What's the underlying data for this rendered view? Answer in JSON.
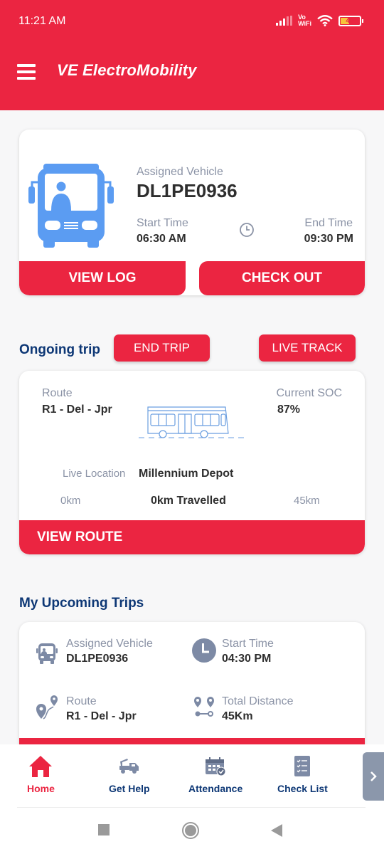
{
  "status_bar": {
    "time": "11:21 AM",
    "network": "Vo WiFi",
    "network_line1": "Vo",
    "network_line2": "WiFi",
    "battery": "40",
    "icons": [
      "signal-icon",
      "vowifi-icon",
      "wifi-icon",
      "battery-icon"
    ]
  },
  "header": {
    "title": "VE ElectroMobility",
    "menu_icon": "hamburger-menu-icon"
  },
  "colors": {
    "primary": "#eb2541",
    "heading": "#0d3775",
    "label": "#8b93a6",
    "bus_blue": "#5b9cf2"
  },
  "assignment_card": {
    "vehicle_label": "Assigned Vehicle",
    "vehicle_number": "DL1PE0936",
    "start_time_label": "Start Time",
    "start_time": "06:30 AM",
    "end_time_label": "End Time",
    "end_time": "09:30 PM",
    "view_log_label": "VIEW LOG",
    "check_out_label": "CHECK OUT"
  },
  "ongoing_trip": {
    "title": "Ongoing trip",
    "end_trip_label": "END TRIP",
    "live_track_label": "LIVE TRACK",
    "route_label": "Route",
    "route": "R1 - Del - Jpr",
    "soc_label": "Current SOC",
    "soc": "87%",
    "live_location_label": "Live Location",
    "live_location": "Millennium Depot",
    "start_km": "0km",
    "travelled": "0km Travelled",
    "end_km": "45km",
    "view_route_label": "VIEW ROUTE"
  },
  "upcoming_trips": {
    "title": "My Upcoming Trips",
    "trips": [
      {
        "vehicle_label": "Assigned Vehicle",
        "vehicle_number": "DL1PE0936",
        "start_time_label": "Start Time",
        "start_time": "04:30 PM",
        "route_label": "Route",
        "route": "R1 - Del - Jpr",
        "distance_label": "Total Distance",
        "distance": "45Km"
      }
    ]
  },
  "bottom_nav": {
    "items": [
      {
        "label": "Home",
        "icon": "home-icon",
        "active": true
      },
      {
        "label": "Get Help",
        "icon": "tow-truck-icon",
        "active": false
      },
      {
        "label": "Attendance",
        "icon": "calendar-check-icon",
        "active": false
      },
      {
        "label": "Check List",
        "icon": "checklist-icon",
        "active": false
      }
    ],
    "next_icon": "chevron-right-icon"
  },
  "system_nav": {
    "recents": "recents-button",
    "home": "home-button",
    "back": "back-button"
  }
}
